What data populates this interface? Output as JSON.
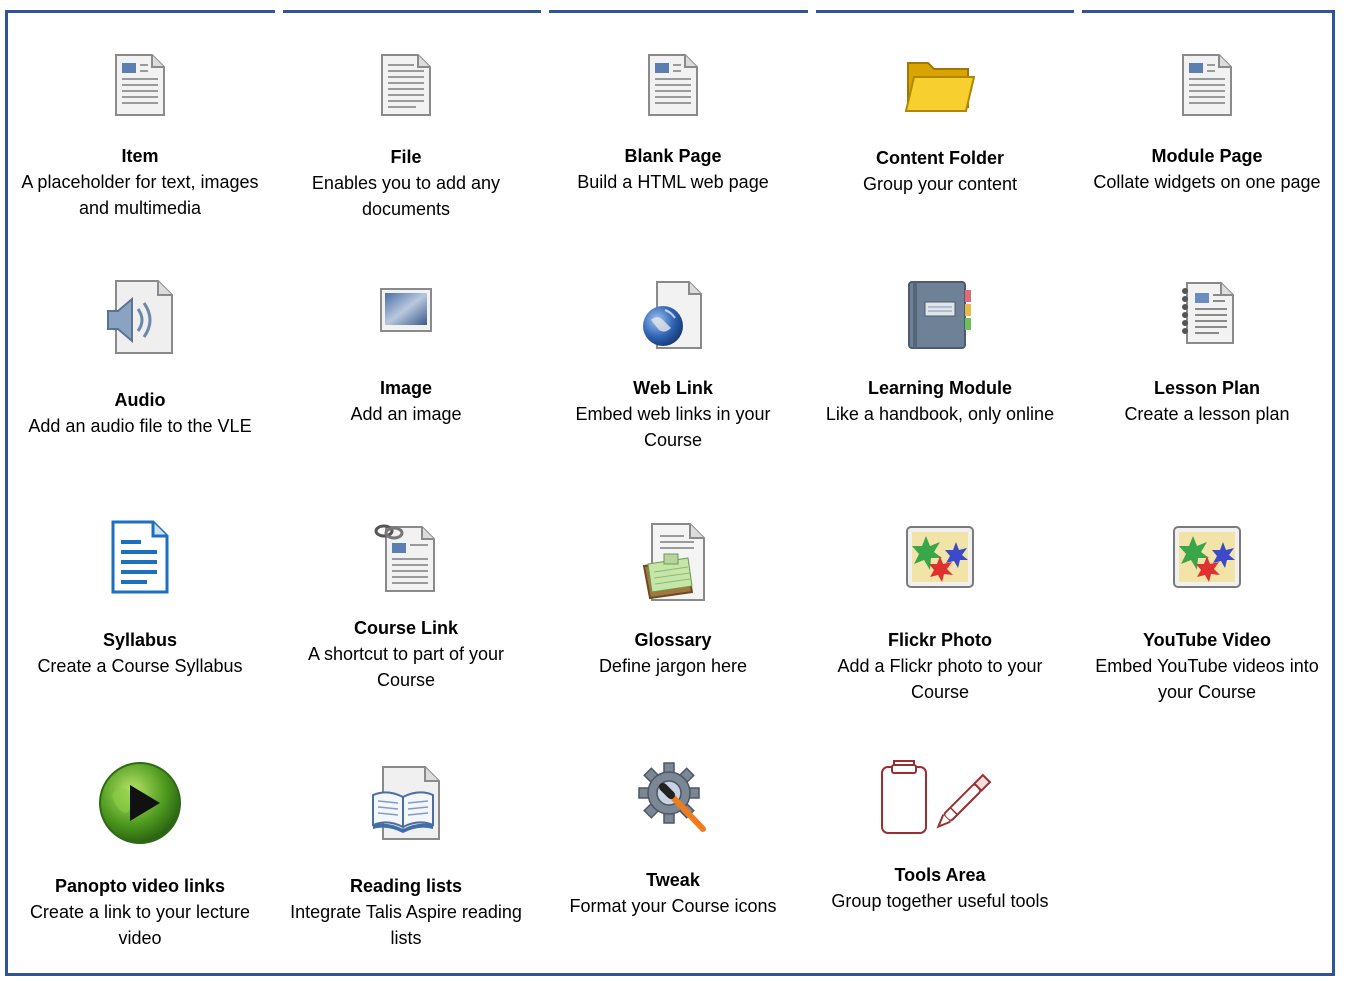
{
  "items": [
    {
      "title": "Item",
      "desc": "A placeholder for text, images and multimedia",
      "icon": "document-icon"
    },
    {
      "title": "File",
      "desc": "Enables you to add any documents",
      "icon": "file-icon"
    },
    {
      "title": "Blank Page",
      "desc": "Build a HTML web page",
      "icon": "document-icon"
    },
    {
      "title": "Content Folder",
      "desc": "Group your content",
      "icon": "folder-icon"
    },
    {
      "title": "Module Page",
      "desc": "Collate widgets on one page",
      "icon": "document-icon"
    },
    {
      "title": "Audio",
      "desc": "Add an audio file to the VLE",
      "icon": "audio-icon"
    },
    {
      "title": "Image",
      "desc": "Add an image",
      "icon": "image-icon"
    },
    {
      "title": "Web Link",
      "desc": "Embed web links in your Course",
      "icon": "globe-icon"
    },
    {
      "title": "Learning Module",
      "desc": "Like a handbook, only online",
      "icon": "notebook-icon"
    },
    {
      "title": "Lesson Plan",
      "desc": "Create a lesson plan",
      "icon": "lesson-plan-icon"
    },
    {
      "title": "Syllabus",
      "desc": "Create a Course Syllabus",
      "icon": "syllabus-icon"
    },
    {
      "title": "Course Link",
      "desc": "A shortcut to part of your Course",
      "icon": "course-link-icon"
    },
    {
      "title": "Glossary",
      "desc": "Define jargon here",
      "icon": "glossary-icon"
    },
    {
      "title": "Flickr Photo",
      "desc": "Add a Flickr photo to your Course",
      "icon": "flickr-icon"
    },
    {
      "title": "YouTube Video",
      "desc": "Embed YouTube videos into your Course",
      "icon": "youtube-icon"
    },
    {
      "title": "Panopto video links",
      "desc": "Create a link to your lecture video",
      "icon": "panopto-play-icon"
    },
    {
      "title": "Reading lists",
      "desc": "Integrate Talis Aspire reading lists",
      "icon": "book-icon"
    },
    {
      "title": "Tweak",
      "desc": "Format your Course icons",
      "icon": "gear-icon"
    },
    {
      "title": "Tools Area",
      "desc": "Group together useful tools",
      "icon": "clipboard-pen-icon"
    }
  ]
}
